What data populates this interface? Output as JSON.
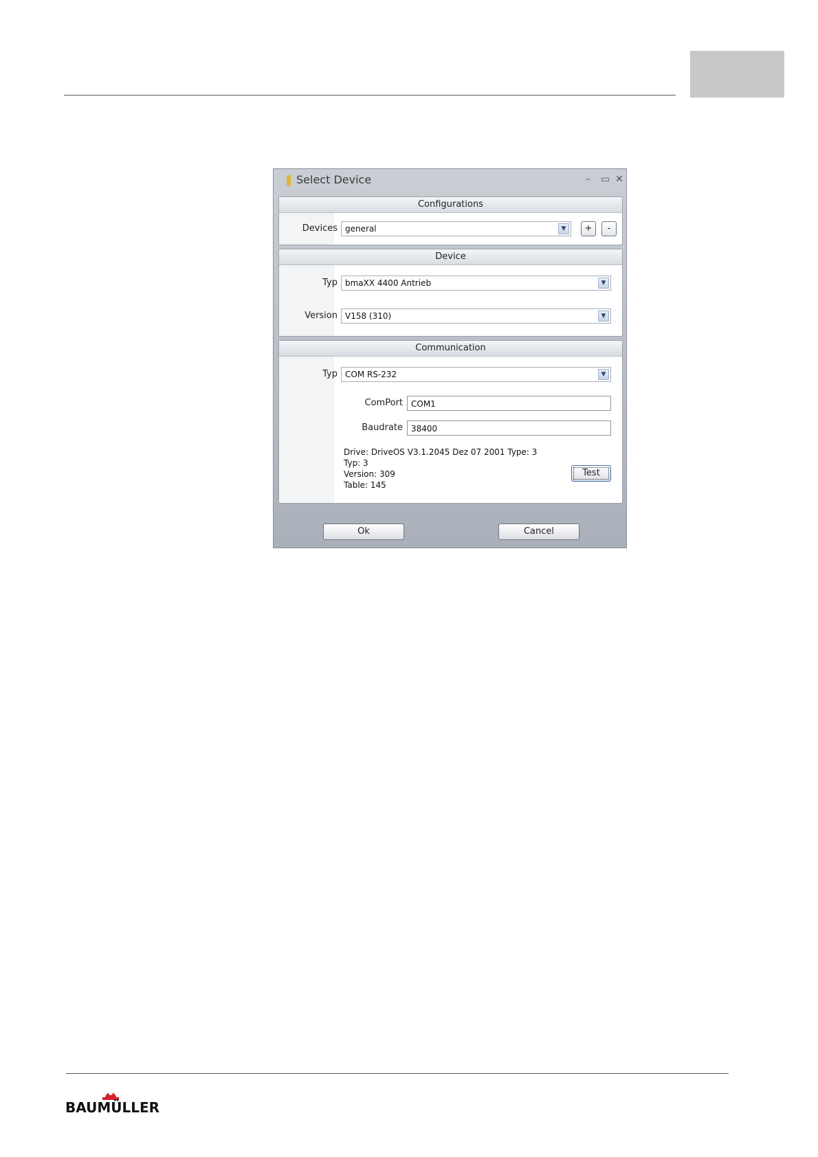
{
  "window": {
    "title": "Select Device",
    "controls": {
      "minimize": "–",
      "maximize": "▭",
      "close": "✕"
    }
  },
  "configurations": {
    "header": "Configurations",
    "devices_label": "Devices",
    "devices_value": "general",
    "add_label": "+",
    "remove_label": "-"
  },
  "device": {
    "header": "Device",
    "typ_label": "Typ",
    "typ_value": "bmaXX 4400 Antrieb",
    "version_label": "Version",
    "version_value": "V158 (310)"
  },
  "communication": {
    "header": "Communication",
    "typ_label": "Typ",
    "typ_value": "COM RS-232",
    "comport_label": "ComPort",
    "comport_value": "COM1",
    "baudrate_label": "Baudrate",
    "baudrate_value": "38400",
    "info_lines": [
      "Drive: DriveOS V3.1.2045 Dez 07 2001 Type: 3",
      "Typ: 3",
      "Version: 309",
      "Table: 145"
    ],
    "test_label": "Test"
  },
  "footer": {
    "ok_label": "Ok",
    "cancel_label": "Cancel"
  },
  "logo": {
    "text": "BAUMÜLLER",
    "accent_color": "#d8232a"
  },
  "icons": {
    "dropdown": "chevron-down-icon",
    "title": "app-icon"
  }
}
